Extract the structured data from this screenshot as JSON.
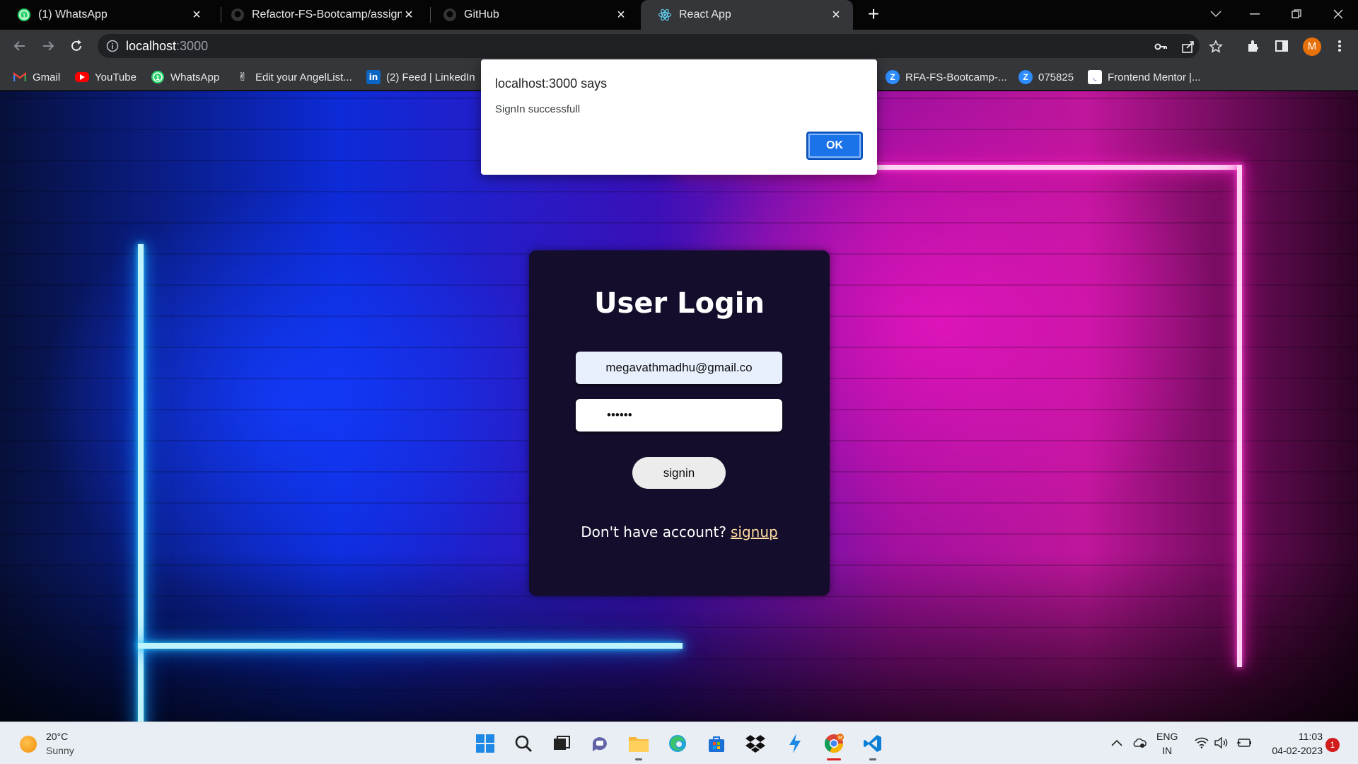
{
  "browser": {
    "tabs": [
      {
        "label": "(1) WhatsApp",
        "icon": "whatsapp-icon",
        "active": false
      },
      {
        "label": "Refactor-FS-Bootcamp/assignme",
        "icon": "github-icon",
        "active": false
      },
      {
        "label": "GitHub",
        "icon": "github-icon",
        "active": false
      },
      {
        "label": "React App",
        "icon": "react-icon",
        "active": true
      }
    ],
    "url_host": "localhost",
    "url_port": ":3000",
    "profile_initial": "M",
    "bookmarks": [
      {
        "label": "Gmail",
        "icon": "gmail-icon"
      },
      {
        "label": "YouTube",
        "icon": "youtube-icon"
      },
      {
        "label": "WhatsApp",
        "icon": "whatsapp-icon"
      },
      {
        "label": "Edit your AngelList...",
        "icon": "angellist-icon"
      },
      {
        "label": "(2) Feed | LinkedIn",
        "icon": "linkedin-icon"
      },
      {
        "label": "RFA-FS-Bootcamp-...",
        "icon": "zoom-icon"
      },
      {
        "label": "075825",
        "icon": "zoom-icon"
      },
      {
        "label": "Frontend Mentor |...",
        "icon": "frontend-mentor-icon"
      }
    ]
  },
  "alert": {
    "title": "localhost:3000 says",
    "message": "SignIn successfull",
    "ok_label": "OK"
  },
  "login": {
    "title": "User Login",
    "email_value": "megavathmadhu@gmail.co",
    "password_value": "••••••",
    "signin_label": "signin",
    "signup_prompt": "Don't have account?",
    "signup_link": "signup"
  },
  "taskbar": {
    "temperature": "20°C",
    "condition": "Sunny",
    "lang_top": "ENG",
    "lang_bottom": "IN",
    "time": "11:03",
    "date": "04-02-2023",
    "notification_count": "1"
  },
  "colors": {
    "card_bg": "#140d2b",
    "alert_ok": "#1a73e8",
    "signup_link": "#ffdca0",
    "neon_left": "#2fd6ff",
    "neon_right": "#ff4fd8"
  }
}
